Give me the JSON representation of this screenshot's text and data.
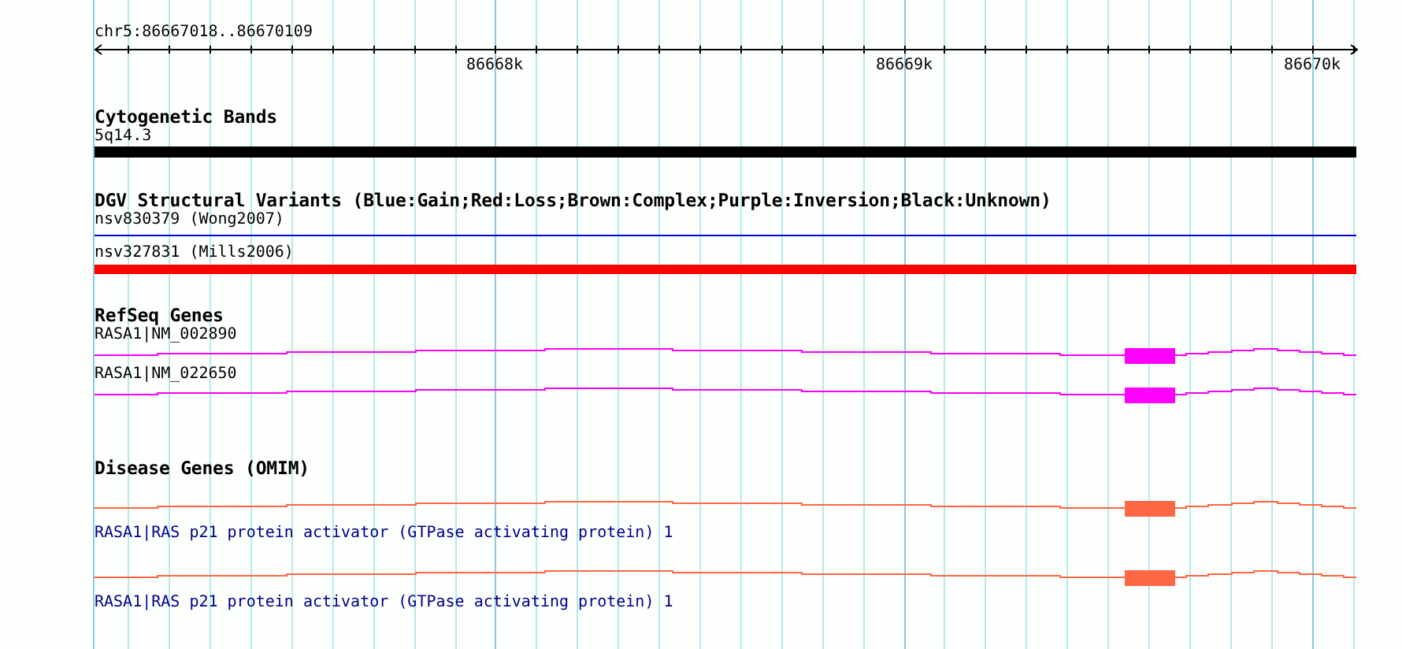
{
  "location": "chr5:86667018..86670109",
  "ruler": {
    "labels": [
      "86668k",
      "86669k",
      "86670k"
    ]
  },
  "tracks": [
    {
      "kind": "cytoband",
      "title": "Cytogenetic Bands",
      "features": [
        {
          "kind": "band",
          "label": "5q14.3",
          "color": "#000000"
        }
      ]
    },
    {
      "kind": "variants",
      "title": "DGV Structural Variants (Blue:Gain;Red:Loss;Brown:Complex;Purple:Inversion;Black:Unknown)",
      "features": [
        {
          "kind": "line",
          "label": "nsv830379 (Wong2007)",
          "color": "#0000cc"
        },
        {
          "kind": "bar",
          "label": "nsv327831 (Mills2006)",
          "color": "#ff0000"
        }
      ]
    },
    {
      "kind": "genes",
      "title": "RefSeq Genes",
      "features": [
        {
          "kind": "gene",
          "label": "RASA1|NM_002890",
          "color": "#ff00ff"
        },
        {
          "kind": "gene",
          "label": "RASA1|NM_022650",
          "color": "#ff00ff"
        }
      ]
    },
    {
      "kind": "disease",
      "title": "Disease Genes (OMIM)",
      "features": [
        {
          "kind": "gene",
          "label": "RASA1|RAS p21 protein activator (GTPase activating protein) 1",
          "color": "#ff6644"
        },
        {
          "kind": "gene",
          "label": "RASA1|RAS p21 protein activator (GTPase activating protein) 1",
          "color": "#ff6644"
        }
      ]
    }
  ]
}
